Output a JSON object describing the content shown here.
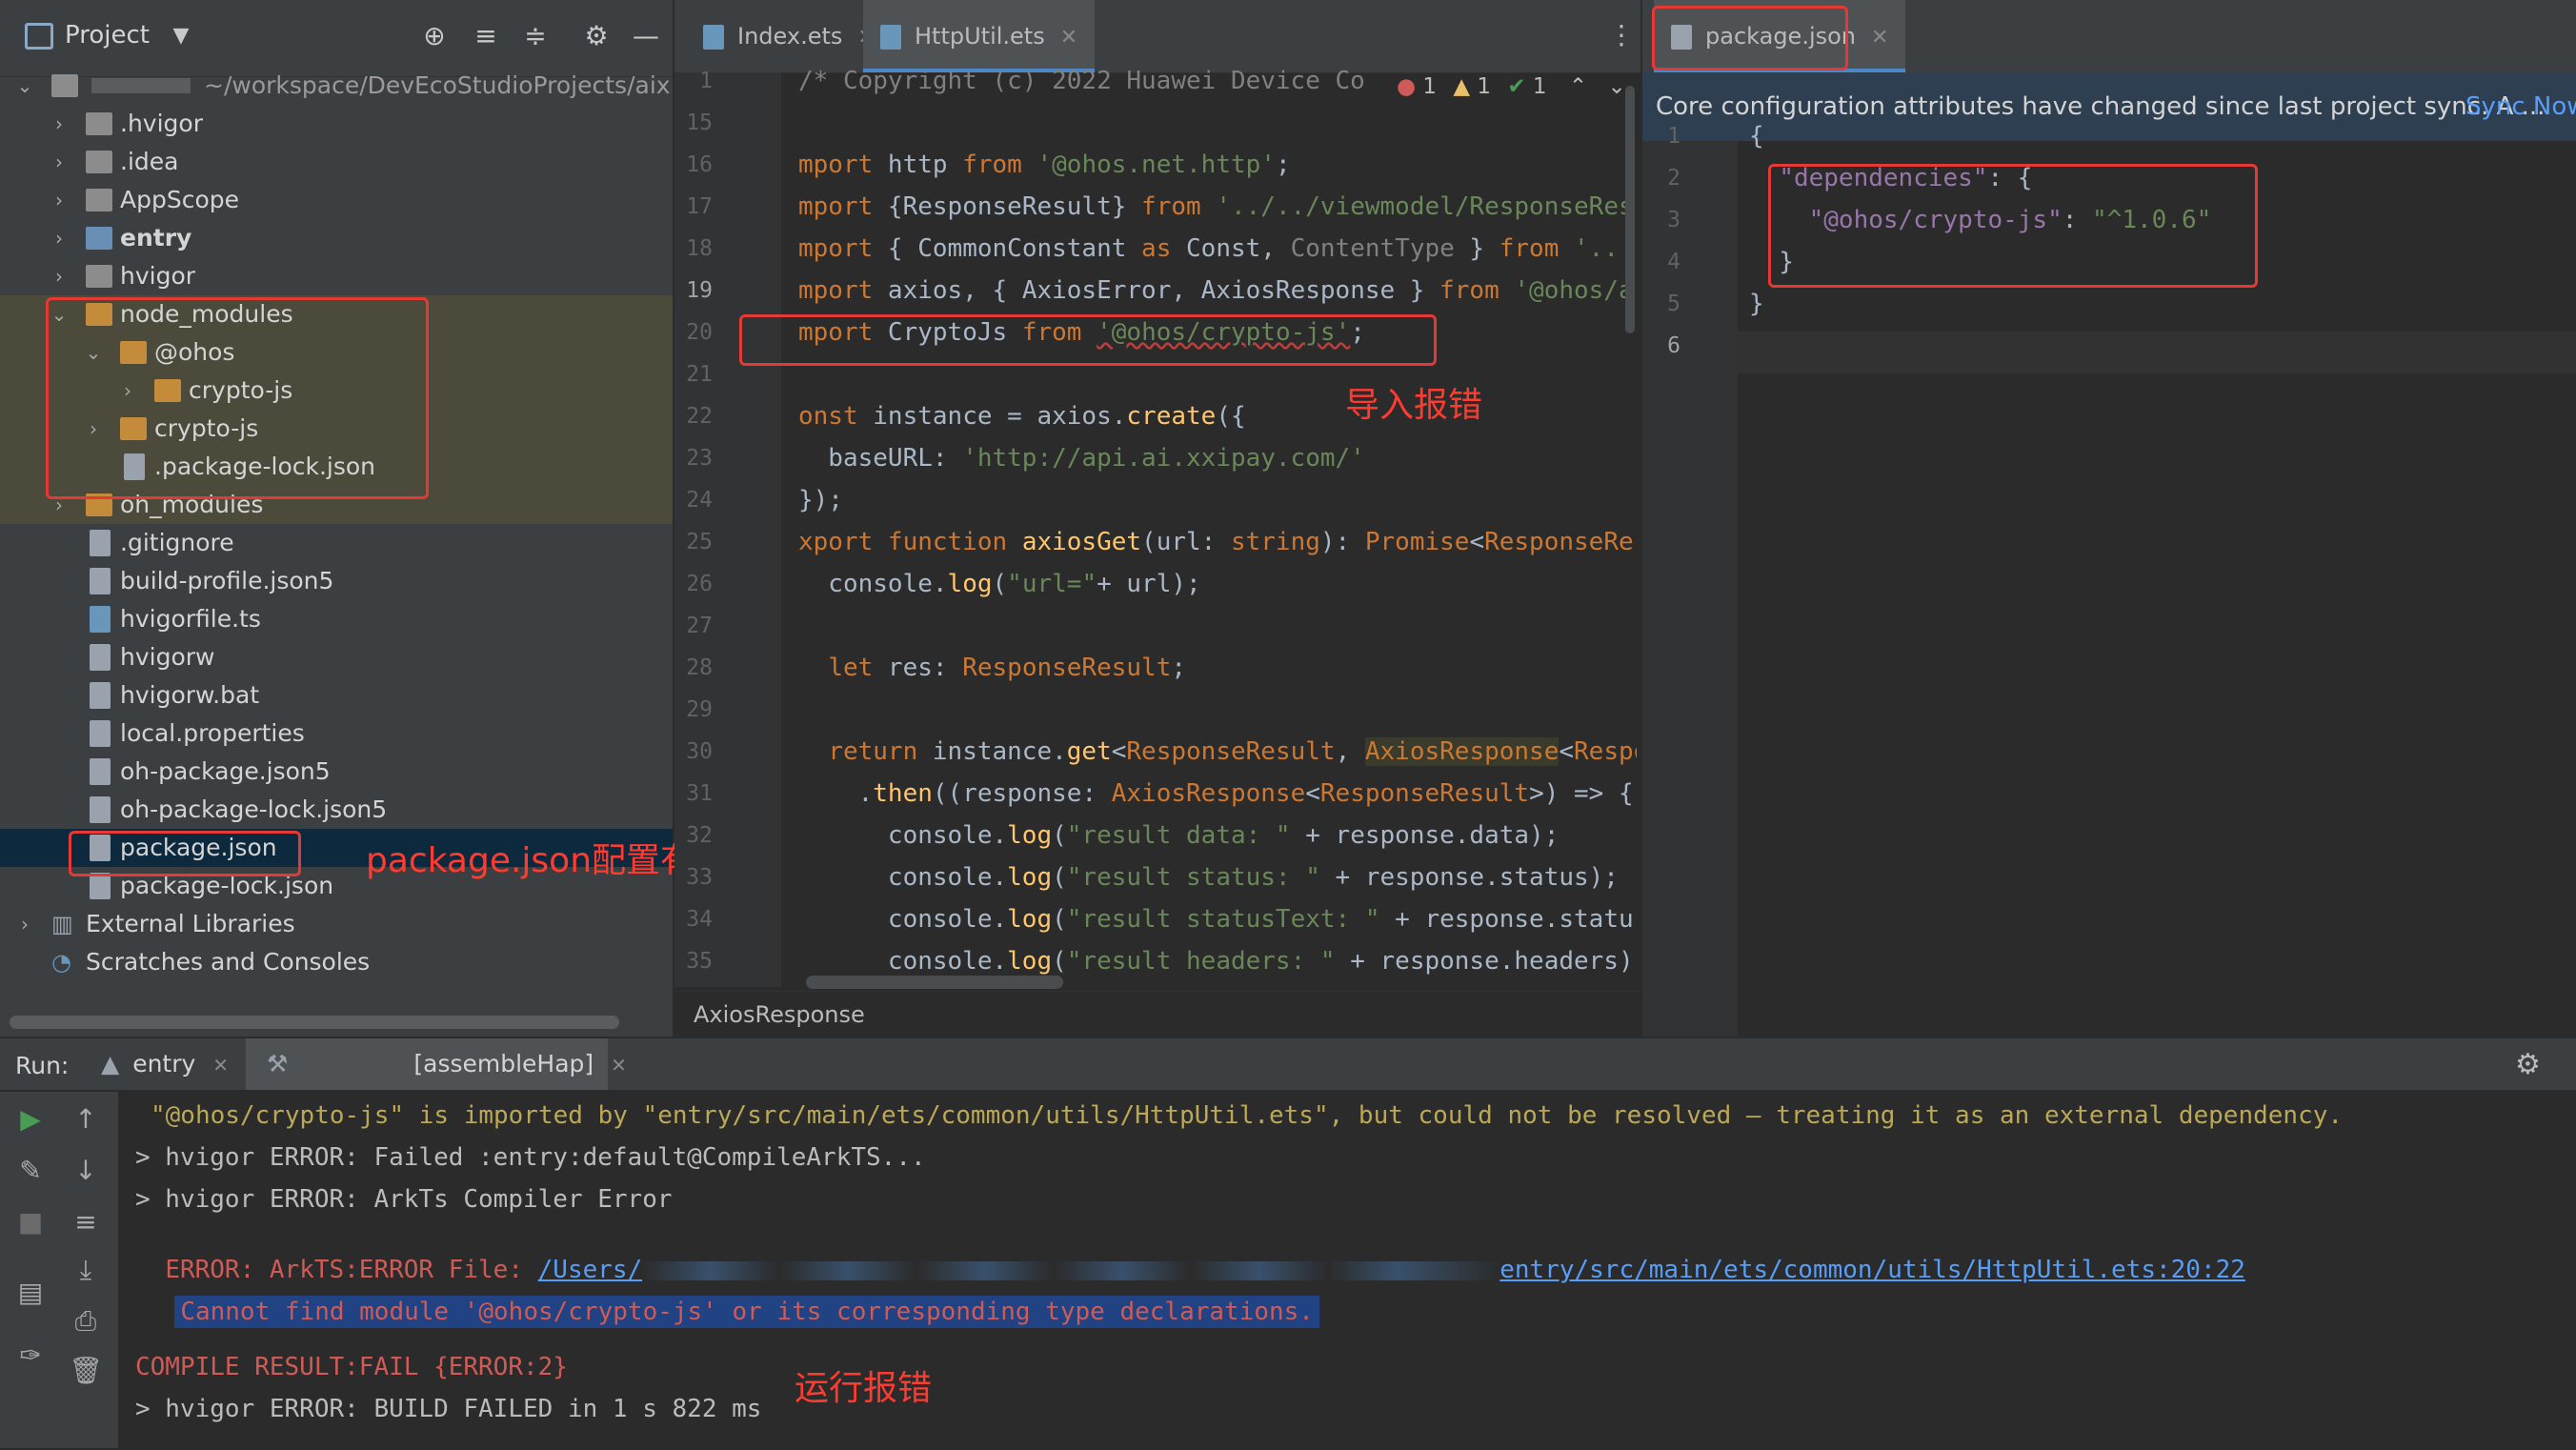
{
  "project_panel": {
    "title": "Project",
    "root_path": "~/workspace/DevEcoStudioProjects/aixiez",
    "items": [
      {
        "label": ".hvigor"
      },
      {
        "label": ".idea"
      },
      {
        "label": "AppScope"
      },
      {
        "label": "entry"
      },
      {
        "label": "hvigor"
      },
      {
        "label": "node_modules"
      },
      {
        "label": "@ohos"
      },
      {
        "label": "crypto-js"
      },
      {
        "label": "crypto-js"
      },
      {
        "label": ".package-lock.json"
      },
      {
        "label": "oh_modules"
      },
      {
        "label": ".gitignore"
      },
      {
        "label": "build-profile.json5"
      },
      {
        "label": "hvigorfile.ts"
      },
      {
        "label": "hvigorw"
      },
      {
        "label": "hvigorw.bat"
      },
      {
        "label": "local.properties"
      },
      {
        "label": "oh-package.json5"
      },
      {
        "label": "oh-package-lock.json5"
      },
      {
        "label": "package.json"
      },
      {
        "label": "package-lock.json"
      },
      {
        "label": "External Libraries"
      },
      {
        "label": "Scratches and Consoles"
      }
    ]
  },
  "annotations": {
    "package_note": "package.json配置有依赖",
    "import_error_note": "导入报错",
    "run_error_note": "运行报错"
  },
  "editor_left": {
    "tabs": [
      {
        "label": "Index.ets"
      },
      {
        "label": "HttpUtil.ets"
      }
    ],
    "inspections": {
      "errors": "1",
      "warnings": "1",
      "ok": "1"
    },
    "line_numbers": [
      "1",
      "15",
      "16",
      "17",
      "18",
      "19",
      "20",
      "21",
      "22",
      "23",
      "24",
      "25",
      "26",
      "27",
      "28",
      "29",
      "30",
      "31",
      "32",
      "33",
      "34",
      "35"
    ],
    "breadcrumb": "AxiosResponse"
  },
  "editor_right": {
    "tab": "package.json",
    "notice": "Core configuration attributes have changed since last project sync. A ...",
    "notice_link": "Sync Now",
    "line_numbers": [
      "1",
      "2",
      "3",
      "4",
      "5",
      "6"
    ]
  },
  "run_panel": {
    "label": "Run:",
    "tabs": [
      {
        "label": "entry"
      },
      {
        "label": "[assembleHap]"
      }
    ],
    "lines": [
      "\"@ohos/crypto-js\" is imported by \"entry/src/main/ets/common/utils/HttpUtil.ets\", but could not be resolved – treating it as an external dependency.",
      "> hvigor ERROR: Failed :entry:default@CompileArkTS...",
      "> hvigor ERROR: ArkTs Compiler Error",
      "ERROR: ArkTS:ERROR File: ",
      "/Users/",
      "entry/src/main/ets/common/utils/HttpUtil.ets:20:22",
      "Cannot find module '@ohos/crypto-js' or its corresponding type declarations.",
      "COMPILE RESULT:FAIL {ERROR:2}",
      "> hvigor ERROR: BUILD FAILED in 1 s 822 ms"
    ]
  },
  "colors": {
    "annotation_red": "#e53935",
    "selection": "#0d293e",
    "accent": "#4a88c7"
  }
}
